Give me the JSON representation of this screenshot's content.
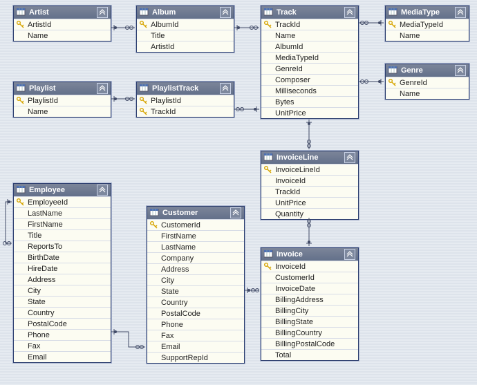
{
  "tables": {
    "artist": {
      "title": "Artist",
      "fields": [
        {
          "name": "ArtistId",
          "pk": true
        },
        {
          "name": "Name",
          "pk": false
        }
      ]
    },
    "album": {
      "title": "Album",
      "fields": [
        {
          "name": "AlbumId",
          "pk": true
        },
        {
          "name": "Title",
          "pk": false
        },
        {
          "name": "ArtistId",
          "pk": false
        }
      ]
    },
    "track": {
      "title": "Track",
      "fields": [
        {
          "name": "TrackId",
          "pk": true
        },
        {
          "name": "Name",
          "pk": false
        },
        {
          "name": "AlbumId",
          "pk": false
        },
        {
          "name": "MediaTypeId",
          "pk": false
        },
        {
          "name": "GenreId",
          "pk": false
        },
        {
          "name": "Composer",
          "pk": false
        },
        {
          "name": "Milliseconds",
          "pk": false
        },
        {
          "name": "Bytes",
          "pk": false
        },
        {
          "name": "UnitPrice",
          "pk": false
        }
      ]
    },
    "mediatype": {
      "title": "MediaType",
      "fields": [
        {
          "name": "MediaTypeId",
          "pk": true
        },
        {
          "name": "Name",
          "pk": false
        }
      ]
    },
    "genre": {
      "title": "Genre",
      "fields": [
        {
          "name": "GenreId",
          "pk": true
        },
        {
          "name": "Name",
          "pk": false
        }
      ]
    },
    "playlist": {
      "title": "Playlist",
      "fields": [
        {
          "name": "PlaylistId",
          "pk": true
        },
        {
          "name": "Name",
          "pk": false
        }
      ]
    },
    "playlisttrack": {
      "title": "PlaylistTrack",
      "fields": [
        {
          "name": "PlaylistId",
          "pk": true
        },
        {
          "name": "TrackId",
          "pk": true
        }
      ]
    },
    "invoiceline": {
      "title": "InvoiceLine",
      "fields": [
        {
          "name": "InvoiceLineId",
          "pk": true
        },
        {
          "name": "InvoiceId",
          "pk": false
        },
        {
          "name": "TrackId",
          "pk": false
        },
        {
          "name": "UnitPrice",
          "pk": false
        },
        {
          "name": "Quantity",
          "pk": false
        }
      ]
    },
    "invoice": {
      "title": "Invoice",
      "fields": [
        {
          "name": "InvoiceId",
          "pk": true
        },
        {
          "name": "CustomerId",
          "pk": false
        },
        {
          "name": "InvoiceDate",
          "pk": false
        },
        {
          "name": "BillingAddress",
          "pk": false
        },
        {
          "name": "BillingCity",
          "pk": false
        },
        {
          "name": "BillingState",
          "pk": false
        },
        {
          "name": "BillingCountry",
          "pk": false
        },
        {
          "name": "BillingPostalCode",
          "pk": false
        },
        {
          "name": "Total",
          "pk": false
        }
      ]
    },
    "customer": {
      "title": "Customer",
      "fields": [
        {
          "name": "CustomerId",
          "pk": true
        },
        {
          "name": "FirstName",
          "pk": false
        },
        {
          "name": "LastName",
          "pk": false
        },
        {
          "name": "Company",
          "pk": false
        },
        {
          "name": "Address",
          "pk": false
        },
        {
          "name": "City",
          "pk": false
        },
        {
          "name": "State",
          "pk": false
        },
        {
          "name": "Country",
          "pk": false
        },
        {
          "name": "PostalCode",
          "pk": false
        },
        {
          "name": "Phone",
          "pk": false
        },
        {
          "name": "Fax",
          "pk": false
        },
        {
          "name": "Email",
          "pk": false
        },
        {
          "name": "SupportRepId",
          "pk": false
        }
      ]
    },
    "employee": {
      "title": "Employee",
      "fields": [
        {
          "name": "EmployeeId",
          "pk": true
        },
        {
          "name": "LastName",
          "pk": false
        },
        {
          "name": "FirstName",
          "pk": false
        },
        {
          "name": "Title",
          "pk": false
        },
        {
          "name": "ReportsTo",
          "pk": false
        },
        {
          "name": "BirthDate",
          "pk": false
        },
        {
          "name": "HireDate",
          "pk": false
        },
        {
          "name": "Address",
          "pk": false
        },
        {
          "name": "City",
          "pk": false
        },
        {
          "name": "State",
          "pk": false
        },
        {
          "name": "Country",
          "pk": false
        },
        {
          "name": "PostalCode",
          "pk": false
        },
        {
          "name": "Phone",
          "pk": false
        },
        {
          "name": "Fax",
          "pk": false
        },
        {
          "name": "Email",
          "pk": false
        }
      ]
    }
  },
  "relationships": [
    {
      "from": "album",
      "to": "artist",
      "via": "ArtistId"
    },
    {
      "from": "track",
      "to": "album",
      "via": "AlbumId"
    },
    {
      "from": "track",
      "to": "mediatype",
      "via": "MediaTypeId"
    },
    {
      "from": "track",
      "to": "genre",
      "via": "GenreId"
    },
    {
      "from": "playlisttrack",
      "to": "playlist",
      "via": "PlaylistId"
    },
    {
      "from": "playlisttrack",
      "to": "track",
      "via": "TrackId"
    },
    {
      "from": "invoiceline",
      "to": "track",
      "via": "TrackId"
    },
    {
      "from": "invoiceline",
      "to": "invoice",
      "via": "InvoiceId"
    },
    {
      "from": "invoice",
      "to": "customer",
      "via": "CustomerId"
    },
    {
      "from": "customer",
      "to": "employee",
      "via": "SupportRepId"
    },
    {
      "from": "employee",
      "to": "employee",
      "via": "ReportsTo"
    }
  ]
}
